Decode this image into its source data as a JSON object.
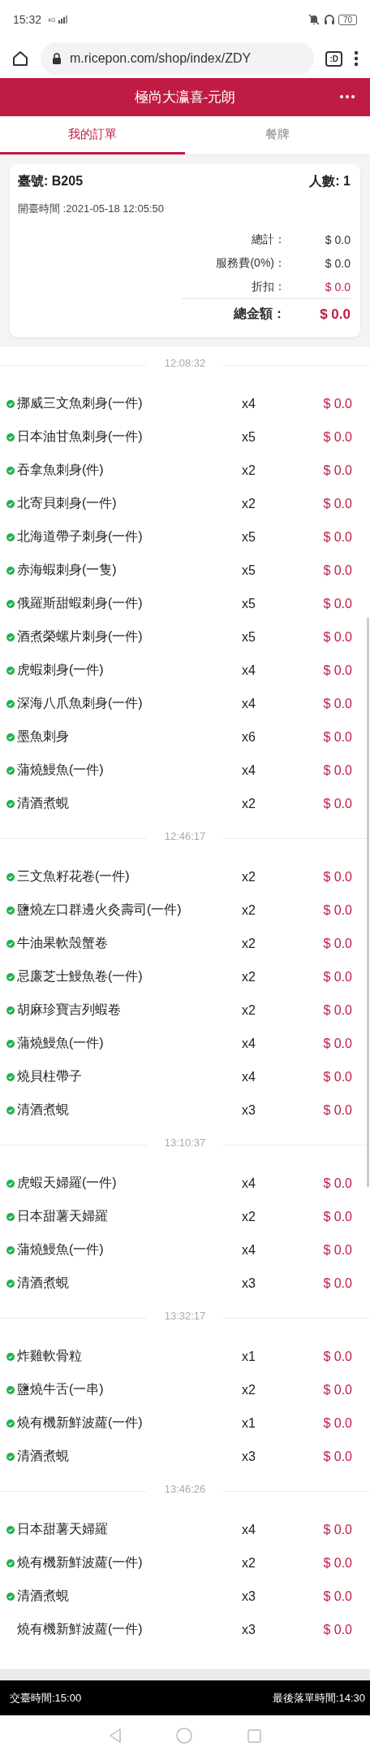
{
  "status_bar": {
    "time": "15:32",
    "network": "4G",
    "battery": "70"
  },
  "browser": {
    "url": "m.ricepon.com/shop/index/ZDY",
    "tab_button": ":D"
  },
  "header": {
    "title": "極尚大瀛喜-元朗"
  },
  "tabs": [
    {
      "label": "我的訂單",
      "selected": true
    },
    {
      "label": "餐牌",
      "selected": false
    }
  ],
  "order": {
    "table_label": "臺號: B205",
    "guests_label": "人數: 1",
    "open_time": "開臺時間 :2021-05-18 12:05:50",
    "summary": [
      {
        "label": "總計：",
        "value": "$ 0.0",
        "kind": "plain"
      },
      {
        "label": "服務費(0%)：",
        "value": "$ 0.0",
        "kind": "plain"
      },
      {
        "label": "折扣：",
        "value": "$ 0.0",
        "kind": "discount"
      },
      {
        "label": "總金額：",
        "value": "$ 0.0",
        "kind": "total"
      }
    ]
  },
  "groups": [
    {
      "time": "12:08:32",
      "items": [
        {
          "name": "挪威三文魚刺身(一件)",
          "qty": "x4",
          "price": "$ 0.0",
          "confirmed": true
        },
        {
          "name": "日本油甘魚刺身(一件)",
          "qty": "x5",
          "price": "$ 0.0",
          "confirmed": true
        },
        {
          "name": "吞拿魚刺身(件)",
          "qty": "x2",
          "price": "$ 0.0",
          "confirmed": true
        },
        {
          "name": "北寄貝刺身(一件)",
          "qty": "x2",
          "price": "$ 0.0",
          "confirmed": true
        },
        {
          "name": "北海道帶子刺身(一件)",
          "qty": "x5",
          "price": "$ 0.0",
          "confirmed": true
        },
        {
          "name": "赤海蝦刺身(一隻)",
          "qty": "x5",
          "price": "$ 0.0",
          "confirmed": true
        },
        {
          "name": "俄羅斯甜蝦刺身(一件)",
          "qty": "x5",
          "price": "$ 0.0",
          "confirmed": true
        },
        {
          "name": "酒煮榮螺片刺身(一件)",
          "qty": "x5",
          "price": "$ 0.0",
          "confirmed": true
        },
        {
          "name": "虎蝦刺身(一件)",
          "qty": "x4",
          "price": "$ 0.0",
          "confirmed": true
        },
        {
          "name": "深海八爪魚刺身(一件)",
          "qty": "x4",
          "price": "$ 0.0",
          "confirmed": true
        },
        {
          "name": "墨魚刺身",
          "qty": "x6",
          "price": "$ 0.0",
          "confirmed": true
        },
        {
          "name": "蒲燒鰻魚(一件)",
          "qty": "x4",
          "price": "$ 0.0",
          "confirmed": true
        },
        {
          "name": "清酒煮蜆",
          "qty": "x2",
          "price": "$ 0.0",
          "confirmed": true
        }
      ]
    },
    {
      "time": "12:46:17",
      "items": [
        {
          "name": "三文魚籽花卷(一件)",
          "qty": "x2",
          "price": "$ 0.0",
          "confirmed": true
        },
        {
          "name": "鹽燒左口群邊火灸壽司(一件)",
          "qty": "x2",
          "price": "$ 0.0",
          "confirmed": true
        },
        {
          "name": "牛油果軟殼蟹卷",
          "qty": "x2",
          "price": "$ 0.0",
          "confirmed": true
        },
        {
          "name": "忌廉芝士鰻魚卷(一件)",
          "qty": "x2",
          "price": "$ 0.0",
          "confirmed": true
        },
        {
          "name": "胡麻珍寶吉列蝦卷",
          "qty": "x2",
          "price": "$ 0.0",
          "confirmed": true
        },
        {
          "name": "蒲燒鰻魚(一件)",
          "qty": "x4",
          "price": "$ 0.0",
          "confirmed": true
        },
        {
          "name": "燒貝柱帶子",
          "qty": "x4",
          "price": "$ 0.0",
          "confirmed": true
        },
        {
          "name": "清酒煮蜆",
          "qty": "x3",
          "price": "$ 0.0",
          "confirmed": true
        }
      ]
    },
    {
      "time": "13:10:37",
      "items": [
        {
          "name": "虎蝦天婦羅(一件)",
          "qty": "x4",
          "price": "$ 0.0",
          "confirmed": true
        },
        {
          "name": "日本甜薯天婦羅",
          "qty": "x2",
          "price": "$ 0.0",
          "confirmed": true
        },
        {
          "name": "蒲燒鰻魚(一件)",
          "qty": "x4",
          "price": "$ 0.0",
          "confirmed": true
        },
        {
          "name": "清酒煮蜆",
          "qty": "x3",
          "price": "$ 0.0",
          "confirmed": true
        }
      ]
    },
    {
      "time": "13:32:17",
      "items": [
        {
          "name": "炸雞軟骨粒",
          "qty": "x1",
          "price": "$ 0.0",
          "confirmed": true
        },
        {
          "name": "鹽燒牛舌(一串)",
          "qty": "x2",
          "price": "$ 0.0",
          "confirmed": true
        },
        {
          "name": "燒有機新鮮波蘿(一件)",
          "qty": "x1",
          "price": "$ 0.0",
          "confirmed": true
        },
        {
          "name": "清酒煮蜆",
          "qty": "x3",
          "price": "$ 0.0",
          "confirmed": true
        }
      ]
    },
    {
      "time": "13:46:26",
      "items": [
        {
          "name": "日本甜薯天婦羅",
          "qty": "x4",
          "price": "$ 0.0",
          "confirmed": true
        },
        {
          "name": "燒有機新鮮波蘿(一件)",
          "qty": "x2",
          "price": "$ 0.0",
          "confirmed": true
        },
        {
          "name": "清酒煮蜆",
          "qty": "x3",
          "price": "$ 0.0",
          "confirmed": true
        },
        {
          "name": "燒有機新鮮波蘿(一件)",
          "qty": "x3",
          "price": "$ 0.0",
          "confirmed": false
        }
      ]
    }
  ],
  "footer": {
    "left": "交臺時間:15:00",
    "right": "最後落單時間:14:30"
  }
}
